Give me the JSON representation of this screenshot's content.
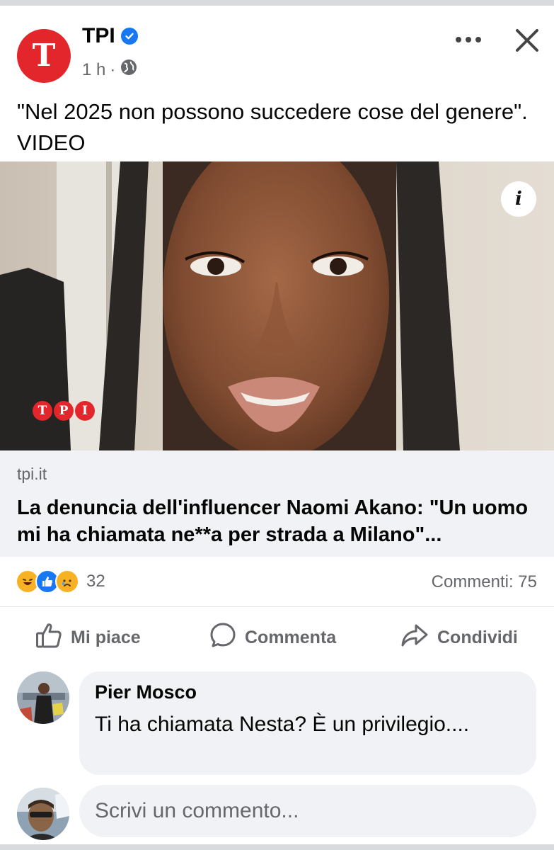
{
  "post": {
    "page_name": "TPI",
    "avatar_letter": "T",
    "time": "1 h",
    "time_separator": "·",
    "privacy_icon": "globe-icon",
    "text": "\"Nel 2025 non possono succedere cose del genere\". VIDEO"
  },
  "media": {
    "info_label": "i",
    "watermark_letters": [
      "T",
      "P",
      "I"
    ]
  },
  "link": {
    "domain": "tpi.it",
    "title": "La denuncia dell'influencer Naomi Akano: \"Un uomo mi ha chiamata ne**a per strada a Milano\"..."
  },
  "stats": {
    "reaction_icons": [
      "haha-icon",
      "like-icon",
      "sad-icon"
    ],
    "reaction_count": "32",
    "comments": "Commenti: 75"
  },
  "actions": {
    "like": "Mi piace",
    "comment": "Commenta",
    "share": "Condividi"
  },
  "comment": {
    "author": "Pier Mosco",
    "text": "Ti ha chiamata Nesta? È un privilegio...."
  },
  "composer": {
    "placeholder": "Scrivi un commento..."
  },
  "colors": {
    "brand_red": "#e3262b",
    "facebook_blue": "#1877f2",
    "secondary_text": "#65676b",
    "bubble_bg": "#f0f2f5"
  }
}
